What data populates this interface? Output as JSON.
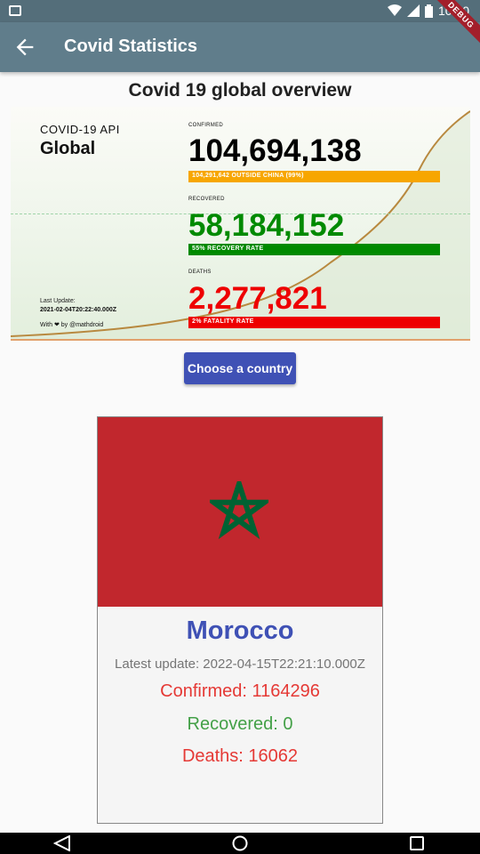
{
  "status_bar": {
    "time": "10:10",
    "debug_label": "DEBUG"
  },
  "app_bar": {
    "title": "Covid Statistics"
  },
  "heading": "Covid 19 global overview",
  "banner": {
    "api_label": "COVID-19 API",
    "region": "Global",
    "confirmed_label": "CONFIRMED",
    "confirmed": "104,694,138",
    "confirmed_note": "104,291,642 OUTSIDE CHINA (99%)",
    "recovered_label": "RECOVERED",
    "recovered": "58,184,152",
    "recovered_note": "55% RECOVERY RATE",
    "deaths_label": "DEATHS",
    "deaths": "2,277,821",
    "deaths_note": "2% FATALITY RATE",
    "last_update_label": "Last Update:",
    "last_update_value": "2021-02-04T20:22:40.000Z",
    "credit": "With ❤ by @mathdroid",
    "colors": {
      "confirmed": "#000000",
      "confirmed_bar": "#f7a600",
      "recovered": "#008a00",
      "recovered_bar": "#008a00",
      "deaths": "#ee0000",
      "deaths_bar": "#ee0000"
    }
  },
  "choose_button": "Choose a country",
  "country_card": {
    "name": "Morocco",
    "latest_update": "Latest update: 2022-04-15T22:21:10.000Z",
    "confirmed": "Confirmed: 1164296",
    "recovered": "Recovered: 0",
    "deaths": "Deaths: 16062",
    "flag_colors": {
      "field": "#c1272d",
      "star": "#006233"
    }
  },
  "icons": {
    "back": "arrow-left-icon",
    "nav": [
      "back-triangle-icon",
      "home-circle-icon",
      "recents-square-icon"
    ]
  }
}
